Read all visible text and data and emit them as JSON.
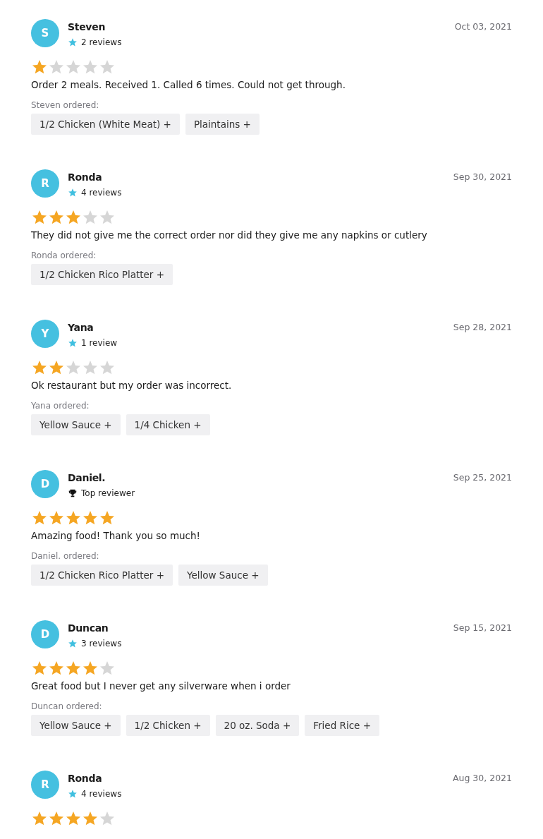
{
  "reviews": [
    {
      "initial": "S",
      "name": "Steven",
      "badge": {
        "kind": "reviews",
        "text": "2 reviews"
      },
      "date": "Oct 03, 2021",
      "stars": 1,
      "text": "Order 2 meals. Received 1. Called 6 times. Could not get through.",
      "ordered_label": "Steven ordered:",
      "items": [
        "1/2 Chicken (White Meat) +",
        "Plaintains +"
      ]
    },
    {
      "initial": "R",
      "name": "Ronda",
      "badge": {
        "kind": "reviews",
        "text": "4 reviews"
      },
      "date": "Sep 30, 2021",
      "stars": 3,
      "text": "They did not give me the correct order nor did they give me any napkins or cutlery",
      "ordered_label": "Ronda ordered:",
      "items": [
        "1/2 Chicken Rico Platter +"
      ]
    },
    {
      "initial": "Y",
      "name": "Yana",
      "badge": {
        "kind": "reviews",
        "text": "1 review"
      },
      "date": "Sep 28, 2021",
      "stars": 2,
      "text": "Ok restaurant but my order was incorrect.",
      "ordered_label": "Yana ordered:",
      "items": [
        "Yellow Sauce +",
        "1/4 Chicken +"
      ]
    },
    {
      "initial": "D",
      "name": "Daniel.",
      "badge": {
        "kind": "top",
        "text": "Top reviewer"
      },
      "date": "Sep 25, 2021",
      "stars": 5,
      "text": "Amazing food! Thank you so much!",
      "ordered_label": "Daniel. ordered:",
      "items": [
        "1/2 Chicken Rico Platter +",
        "Yellow Sauce +"
      ]
    },
    {
      "initial": "D",
      "name": "Duncan",
      "badge": {
        "kind": "reviews",
        "text": "3 reviews"
      },
      "date": "Sep 15, 2021",
      "stars": 4,
      "text": "Great food but I never get any silverware when i order",
      "ordered_label": "Duncan ordered:",
      "items": [
        "Yellow Sauce +",
        "1/2 Chicken +",
        "20 oz. Soda +",
        "Fried Rice +"
      ]
    },
    {
      "initial": "R",
      "name": "Ronda",
      "badge": {
        "kind": "reviews",
        "text": "4 reviews"
      },
      "date": "Aug 30, 2021",
      "stars": 4
    }
  ]
}
